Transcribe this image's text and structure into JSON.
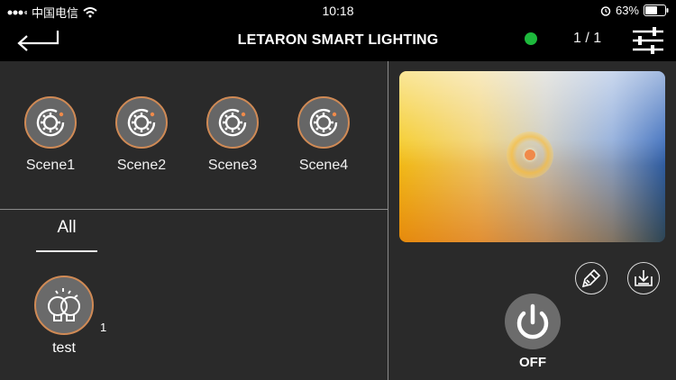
{
  "status": {
    "carrier": "中国电信",
    "time": "10:18",
    "battery": "63%"
  },
  "header": {
    "title": "LETARON SMART LIGHTING",
    "pager": "1 / 1",
    "connection_color": "#1db93c"
  },
  "scenes": [
    {
      "label": "Scene1"
    },
    {
      "label": "Scene2"
    },
    {
      "label": "Scene3"
    },
    {
      "label": "Scene4"
    }
  ],
  "tabs": {
    "all_label": "All"
  },
  "device": {
    "name": "test",
    "count": "1"
  },
  "power": {
    "label": "OFF"
  },
  "colors": {
    "accent_ring": "#d08a55"
  }
}
